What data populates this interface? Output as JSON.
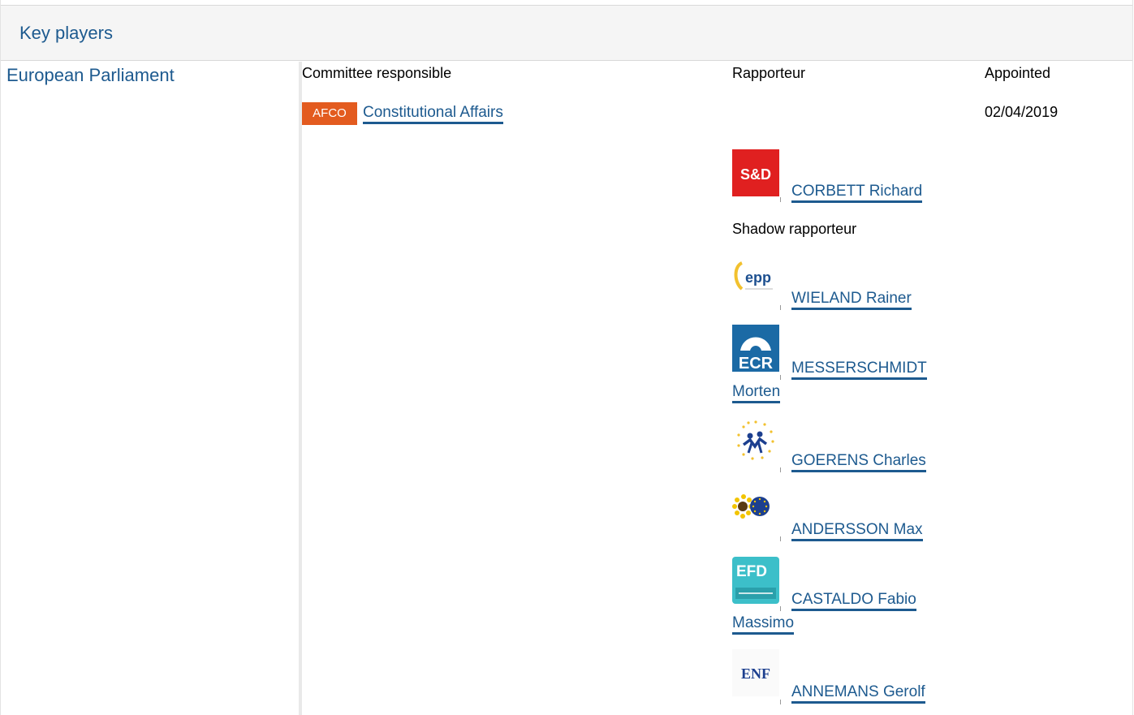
{
  "section": {
    "title": "Key players"
  },
  "institution": "European Parliament",
  "columns": {
    "committee": "Committee responsible",
    "rapporteur": "Rapporteur",
    "appointed": "Appointed"
  },
  "committee": {
    "abbr": "AFCO",
    "name": "Constitutional Affairs",
    "appointed": "02/04/2019",
    "abbr_color": "#e35b1f"
  },
  "rapporteur": {
    "group": "S&D",
    "name": "CORBETT Richard"
  },
  "shadow_label": "Shadow rapporteur",
  "shadows": [
    {
      "group": "epp",
      "name": "WIELAND Rainer"
    },
    {
      "group": "ECR",
      "name_line1": "MESSERSCHMIDT",
      "name_line2": "Morten"
    },
    {
      "group": "renew-logo",
      "name": "GOERENS Charles"
    },
    {
      "group": "greens-efa-logo",
      "name": "ANDERSSON Max"
    },
    {
      "group": "EFD",
      "name_line1": "CASTALDO Fabio",
      "name_line2": "Massimo"
    },
    {
      "group": "ENF",
      "name": "ANNEMANS Gerolf"
    }
  ]
}
